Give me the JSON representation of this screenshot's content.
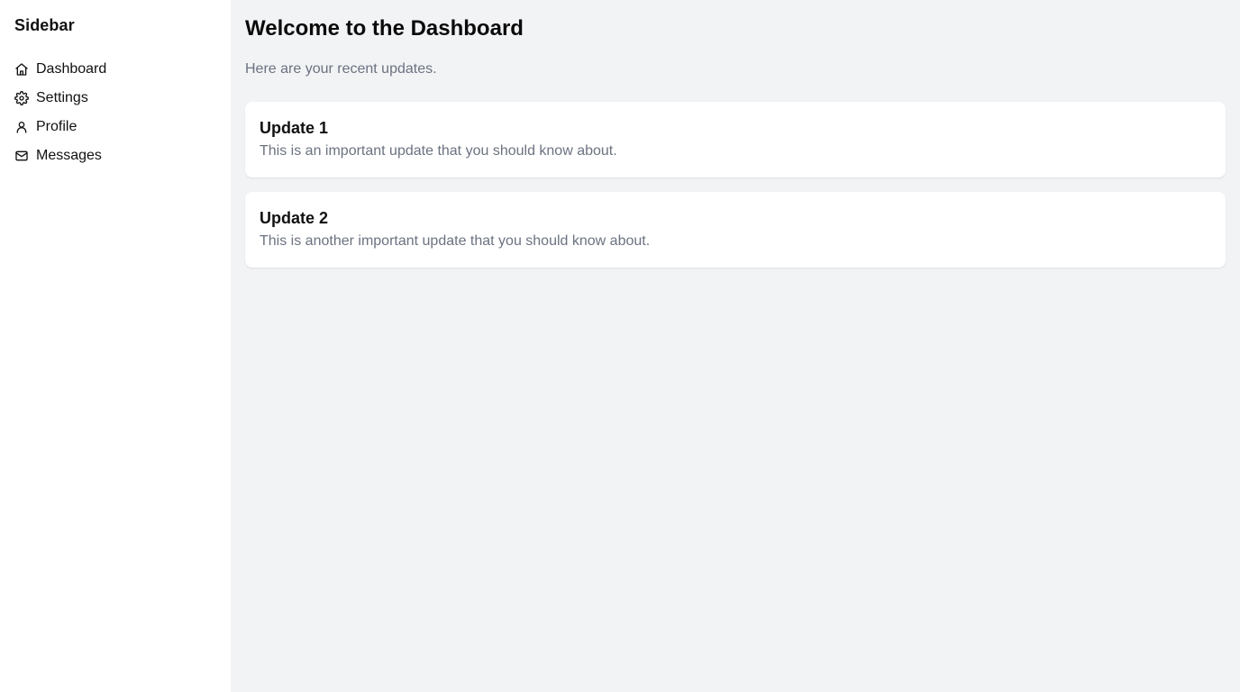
{
  "sidebar": {
    "title": "Sidebar",
    "items": [
      {
        "label": "Dashboard",
        "icon": "home-icon"
      },
      {
        "label": "Settings",
        "icon": "gear-icon"
      },
      {
        "label": "Profile",
        "icon": "user-icon"
      },
      {
        "label": "Messages",
        "icon": "mail-icon"
      }
    ]
  },
  "main": {
    "title": "Welcome to the Dashboard",
    "subtitle": "Here are your recent updates.",
    "updates": [
      {
        "title": "Update 1",
        "text": "This is an important update that you should know about."
      },
      {
        "title": "Update 2",
        "text": "This is another important update that you should know about."
      }
    ]
  },
  "colors": {
    "sidebar_bg": "#ffffff",
    "main_bg": "#f2f3f5",
    "muted_text": "#6b7280",
    "card_bg": "#ffffff"
  }
}
